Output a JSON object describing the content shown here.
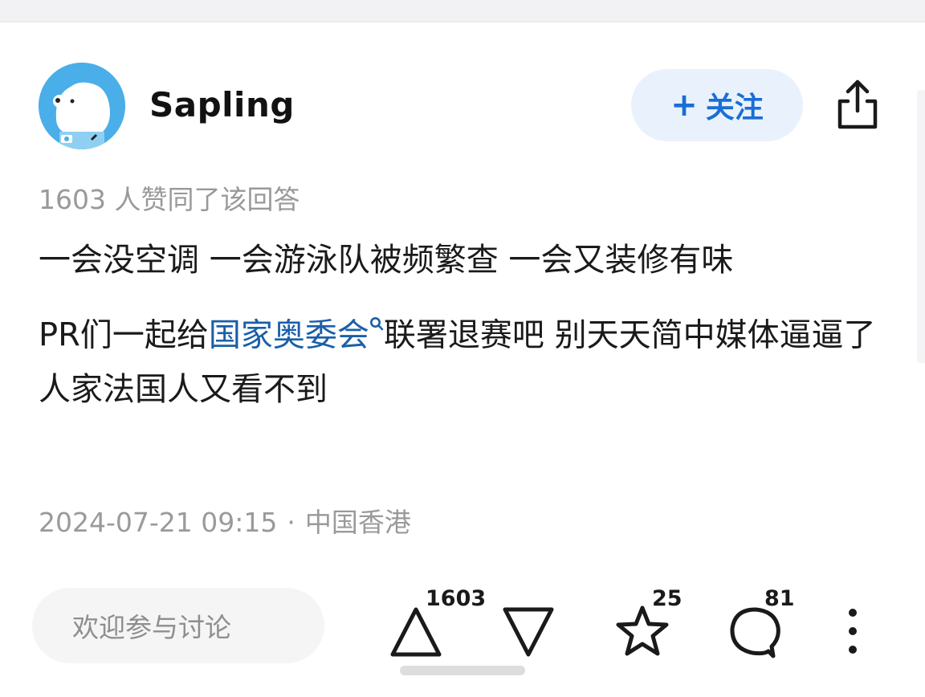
{
  "author": {
    "name": "Sapling",
    "avatar_icon": "polar-bear-avatar-icon"
  },
  "follow_button": {
    "plus": "+",
    "label": "关注"
  },
  "share_icon": "share-icon",
  "vote_summary": "1603 人赞同了该回答",
  "answer": {
    "paragraph_1": "一会没空调 一会游泳队被频繁查 一会又装修有味",
    "paragraph_2_before": "PR们一起给",
    "paragraph_2_link": "国家奥委会",
    "paragraph_2_link_icon": "search-icon",
    "paragraph_2_after": "联署退赛吧 别天天简中媒体逼逼了 人家法国人又看不到"
  },
  "meta": {
    "datetime": "2024-07-21 09:15",
    "separator": "·",
    "location": "中国香港"
  },
  "bottom_bar": {
    "comment_placeholder": "欢迎参与讨论",
    "upvote_count": "1603",
    "favorite_count": "25",
    "comment_count": "81"
  },
  "colors": {
    "accent": "#1a6ed6",
    "follow_bg": "#e9f2fc",
    "link": "#1a5fa8",
    "muted": "#999999"
  }
}
